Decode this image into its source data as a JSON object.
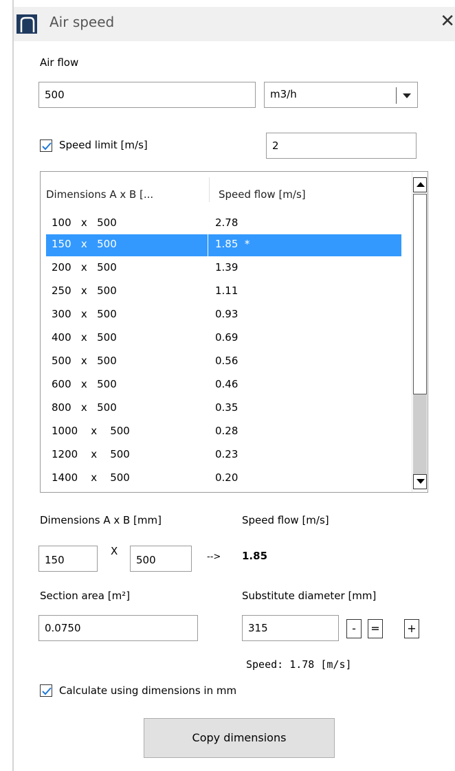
{
  "window": {
    "title": "Air speed",
    "icon": "app-icon",
    "close_icon": "close-icon"
  },
  "airflow": {
    "label": "Air flow",
    "value": "500",
    "unit_selected": "m3/h"
  },
  "speed_limit": {
    "label": "Speed limit [m/s]",
    "checked": true,
    "value": "2"
  },
  "table": {
    "columns": [
      "Dimensions A x B [...",
      "Speed flow [m/s]"
    ],
    "rows": [
      {
        "a": "100   x   500",
        "b": "2.78"
      },
      {
        "a": "150   x   500",
        "b": "1.85  *",
        "selected": true
      },
      {
        "a": "200   x   500",
        "b": "1.39"
      },
      {
        "a": "250   x   500",
        "b": "1.11"
      },
      {
        "a": "300   x   500",
        "b": "0.93"
      },
      {
        "a": "400   x   500",
        "b": "0.69"
      },
      {
        "a": "500   x   500",
        "b": "0.56"
      },
      {
        "a": "600   x   500",
        "b": "0.46"
      },
      {
        "a": "800   x   500",
        "b": "0.35"
      },
      {
        "a": "1000    x    500",
        "b": "0.28"
      },
      {
        "a": "1200    x    500",
        "b": "0.23"
      },
      {
        "a": "1400    x    500",
        "b": "0.20"
      }
    ]
  },
  "dimensions": {
    "label": "Dimensions A x B [mm]",
    "a_value": "150",
    "x_label": "X",
    "b_value": "500",
    "arrow": "-->",
    "speed_label": "Speed flow [m/s]",
    "speed_value": "1.85"
  },
  "section": {
    "label": "Section area [m²]",
    "value": "0.0750"
  },
  "substitute": {
    "label": "Substitute diameter [mm]",
    "value": "315",
    "minus": "-",
    "equals": "=",
    "plus": "+",
    "speed_text": "Speed: 1.78 [m/s]"
  },
  "calc_mm": {
    "label": "Calculate using dimensions in mm",
    "checked": true
  },
  "copy_button": "Copy dimensions",
  "colors": {
    "selection": "#3399ff",
    "checkmark": "#1e78d7",
    "titlebar": "#f0f0f0",
    "button": "#e1e1e1"
  }
}
